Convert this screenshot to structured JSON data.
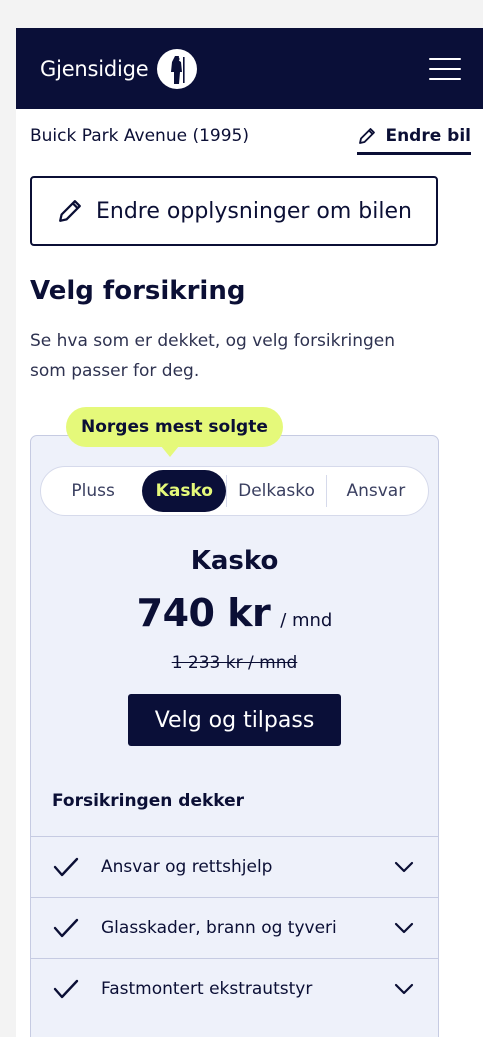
{
  "header": {
    "logo_text": "Gjensidige",
    "menu_icon": "hamburger-menu-icon"
  },
  "car": {
    "name": "Buick Park Avenue (1995)",
    "change_label": "Endre bil"
  },
  "edit_button": {
    "label": "Endre opplysninger om bilen",
    "icon": "pencil-icon"
  },
  "section": {
    "title": "Velg forsikring",
    "intro": "Se hva som er dekket, og velg forsikringen som passer for deg."
  },
  "badge": {
    "label": "Norges mest solgte"
  },
  "tabs": [
    {
      "label": "Pluss",
      "active": false
    },
    {
      "label": "Kasko",
      "active": true
    },
    {
      "label": "Delkasko",
      "active": false
    },
    {
      "label": "Ansvar",
      "active": false
    }
  ],
  "plan": {
    "name": "Kasko",
    "price": "740 kr",
    "period": "/ mnd",
    "old_price": "1 233 kr / mnd",
    "cta_label": "Velg og tilpass"
  },
  "coverage": {
    "heading": "Forsikringen dekker",
    "items": [
      {
        "label": "Ansvar og rettshjelp"
      },
      {
        "label": "Glasskader, brann og tyveri"
      },
      {
        "label": "Fastmontert ekstrautstyr"
      }
    ]
  },
  "colors": {
    "navy": "#0a0f38",
    "accent_lime": "#e5f97a",
    "card_bg": "#eef1fa"
  }
}
